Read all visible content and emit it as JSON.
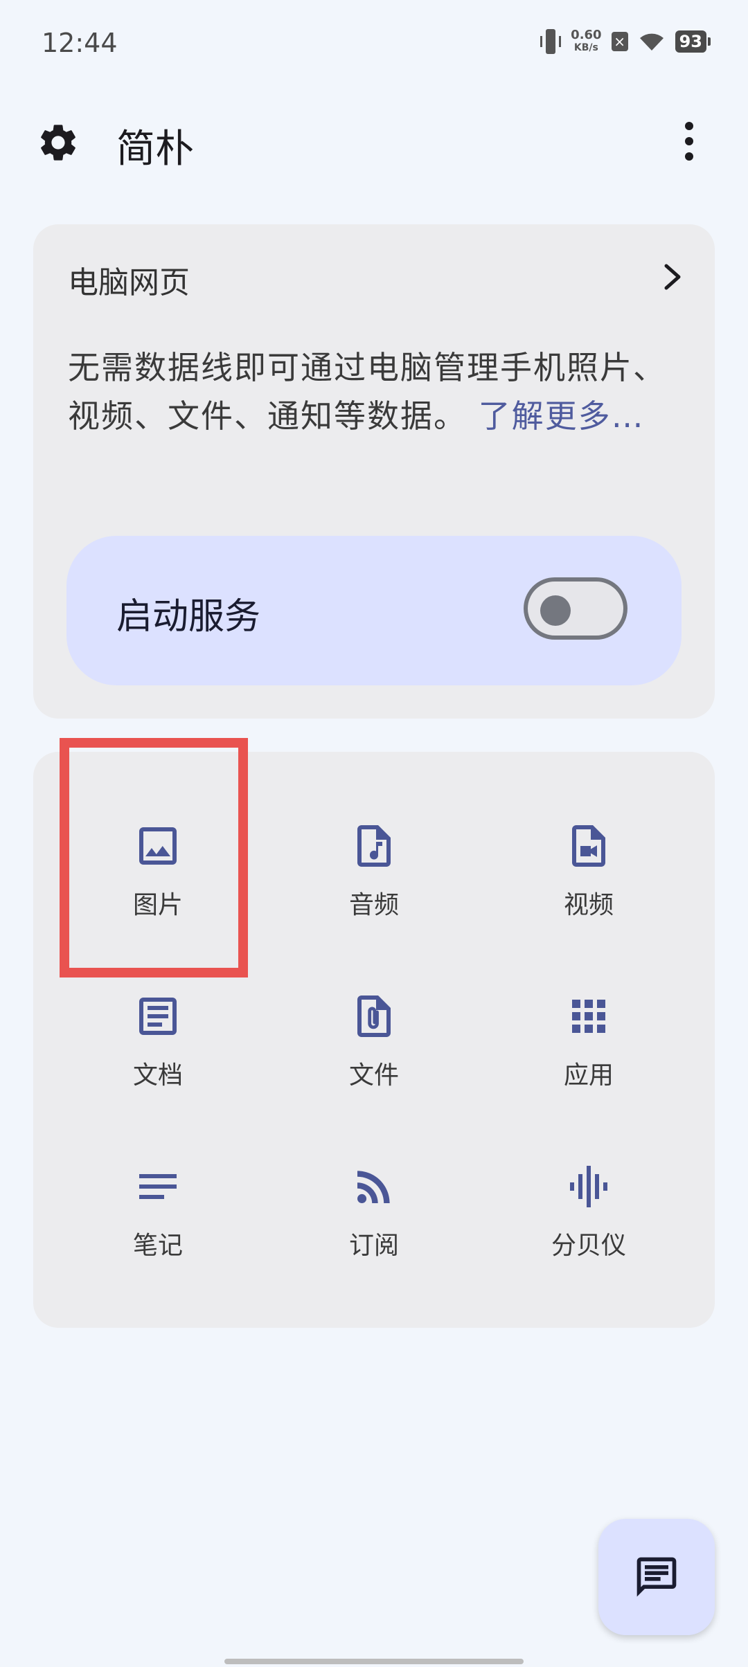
{
  "status_bar": {
    "time": "12:44",
    "net_speed_value": "0.60",
    "net_speed_unit": "KB/s",
    "battery": "93"
  },
  "app_bar": {
    "title": "简朴",
    "settings_icon": "gear-icon",
    "more_icon": "more-vert-icon"
  },
  "web_card": {
    "title": "电脑网页",
    "description": "无需数据线即可通过电脑管理手机照片、视频、文件、通知等数据。",
    "learn_more": "了解更多…",
    "service_label": "启动服务",
    "service_enabled": false
  },
  "features": [
    {
      "label": "图片",
      "icon": "image-icon"
    },
    {
      "label": "音频",
      "icon": "audio-file-icon"
    },
    {
      "label": "视频",
      "icon": "video-file-icon"
    },
    {
      "label": "文档",
      "icon": "document-icon"
    },
    {
      "label": "文件",
      "icon": "attachment-file-icon"
    },
    {
      "label": "应用",
      "icon": "apps-grid-icon"
    },
    {
      "label": "笔记",
      "icon": "notes-lines-icon"
    },
    {
      "label": "订阅",
      "icon": "rss-feed-icon"
    },
    {
      "label": "分贝仪",
      "icon": "sound-wave-icon"
    }
  ],
  "colors": {
    "accent": "#4f5b9e",
    "icon": "#4a5696",
    "highlight": "#e95350",
    "service_bg": "#dce1ff"
  },
  "fab": {
    "icon": "chat-icon"
  }
}
